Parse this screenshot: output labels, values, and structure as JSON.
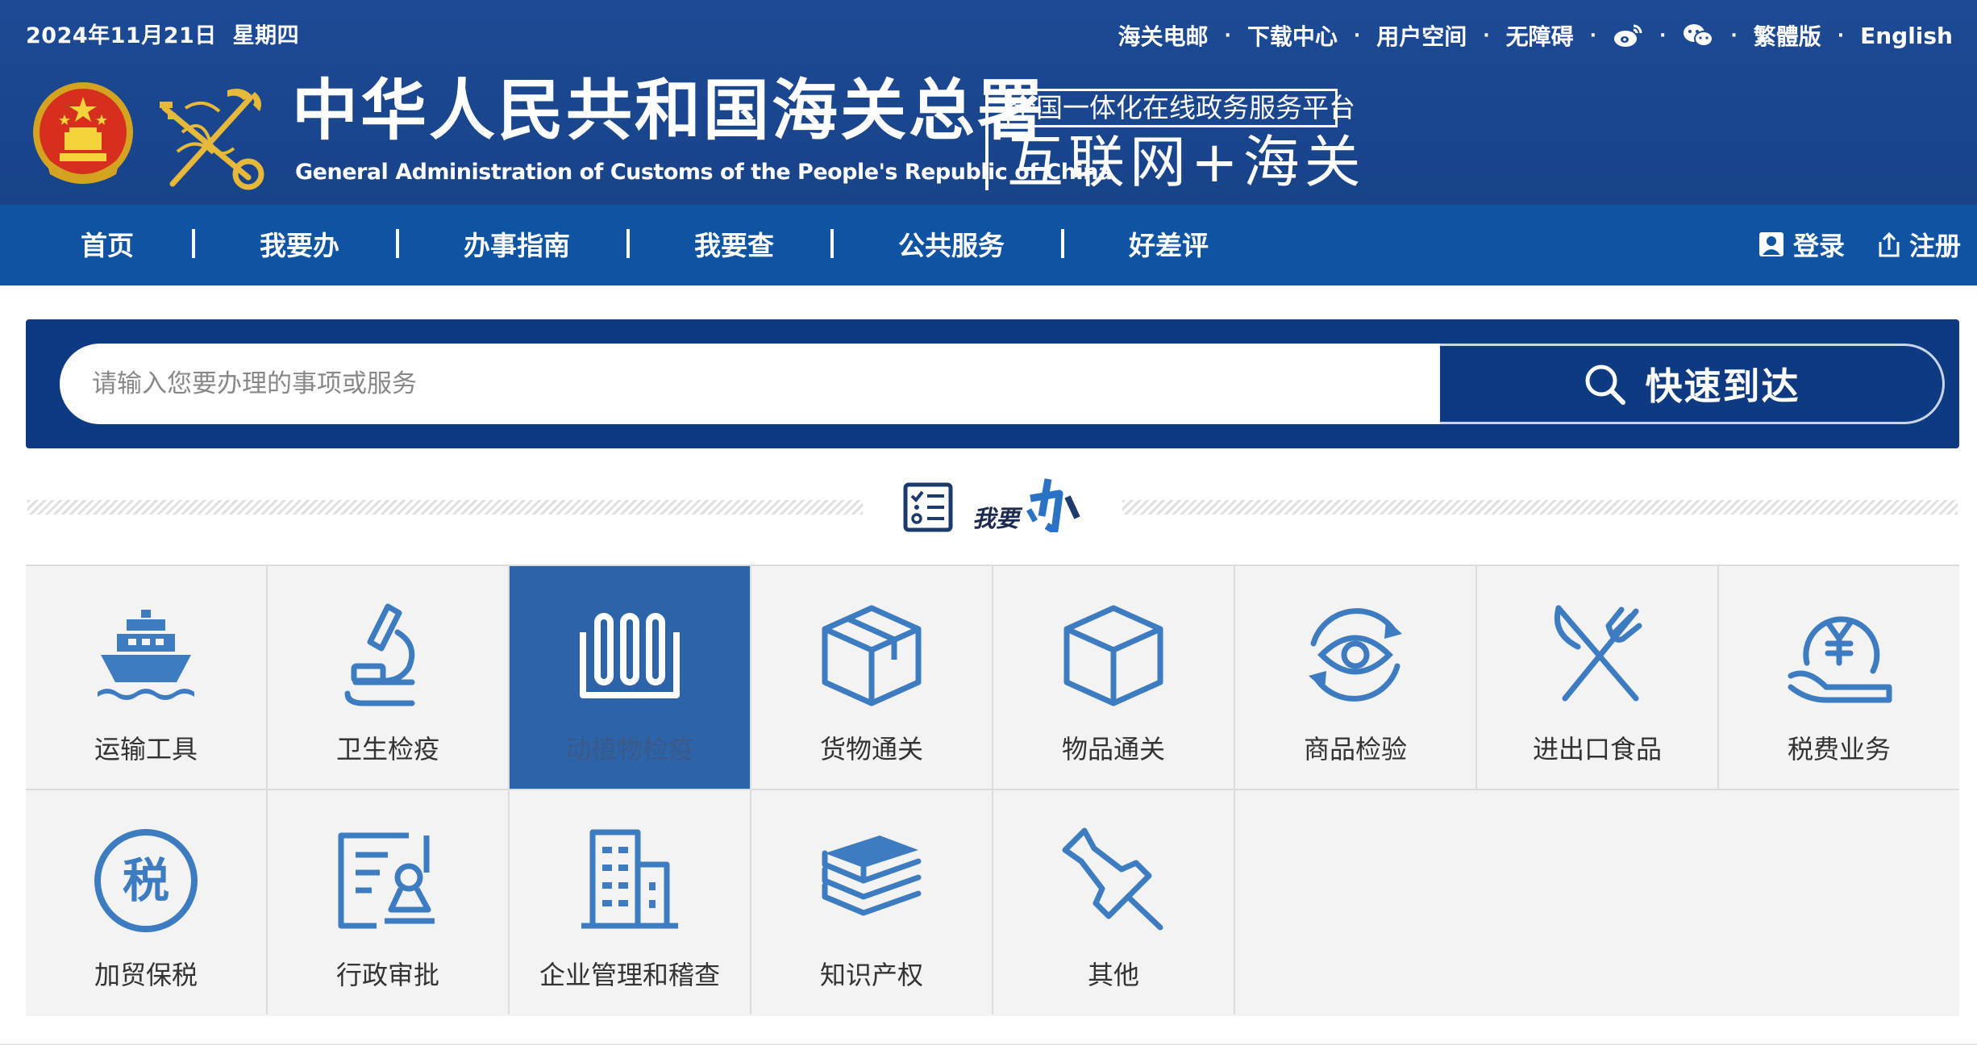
{
  "header": {
    "date": "2024年11月21日",
    "weekday": "星期四",
    "links": [
      "海关电邮",
      "下载中心",
      "用户空间",
      "无障碍"
    ],
    "lang_traditional": "繁體版",
    "lang_english": "English",
    "org_cn": "中华人民共和国海关总署",
    "org_en": "General Administration of Customs of the People's Republic of China",
    "platform_box": "全国一体化在线政务服务平台",
    "platform_big": "互联网+海关"
  },
  "nav": {
    "items": [
      "首页",
      "我要办",
      "办事指南",
      "我要查",
      "公共服务",
      "好差评"
    ],
    "login": "登录",
    "register": "注册"
  },
  "search": {
    "placeholder": "请输入您要办理的事项或服务",
    "button": "快速到达"
  },
  "section": {
    "label": "我要"
  },
  "tiles": [
    {
      "label": "运输工具",
      "icon": "ship-icon"
    },
    {
      "label": "卫生检疫",
      "icon": "microscope-icon"
    },
    {
      "label": "动植物检疫",
      "icon": "barrier-icon",
      "selected": true
    },
    {
      "label": "货物通关",
      "icon": "open-box-icon"
    },
    {
      "label": "物品通关",
      "icon": "cube-icon"
    },
    {
      "label": "商品检验",
      "icon": "eye-cycle-icon"
    },
    {
      "label": "进出口食品",
      "icon": "knife-fork-icon"
    },
    {
      "label": "税费业务",
      "icon": "yuan-hand-icon"
    },
    {
      "label": "加贸保税",
      "icon": "tax-circle-icon"
    },
    {
      "label": "行政审批",
      "icon": "approval-document-icon"
    },
    {
      "label": "企业管理和稽查",
      "icon": "building-icon"
    },
    {
      "label": "知识产权",
      "icon": "books-icon"
    },
    {
      "label": "其他",
      "icon": "pin-icon"
    }
  ],
  "colors": {
    "header_blue": "#1c4a94",
    "nav_blue": "#0f53a3",
    "search_navy": "#0d3a80",
    "icon_blue": "#3d7cc1",
    "selected_tile": "#2d63a8"
  }
}
